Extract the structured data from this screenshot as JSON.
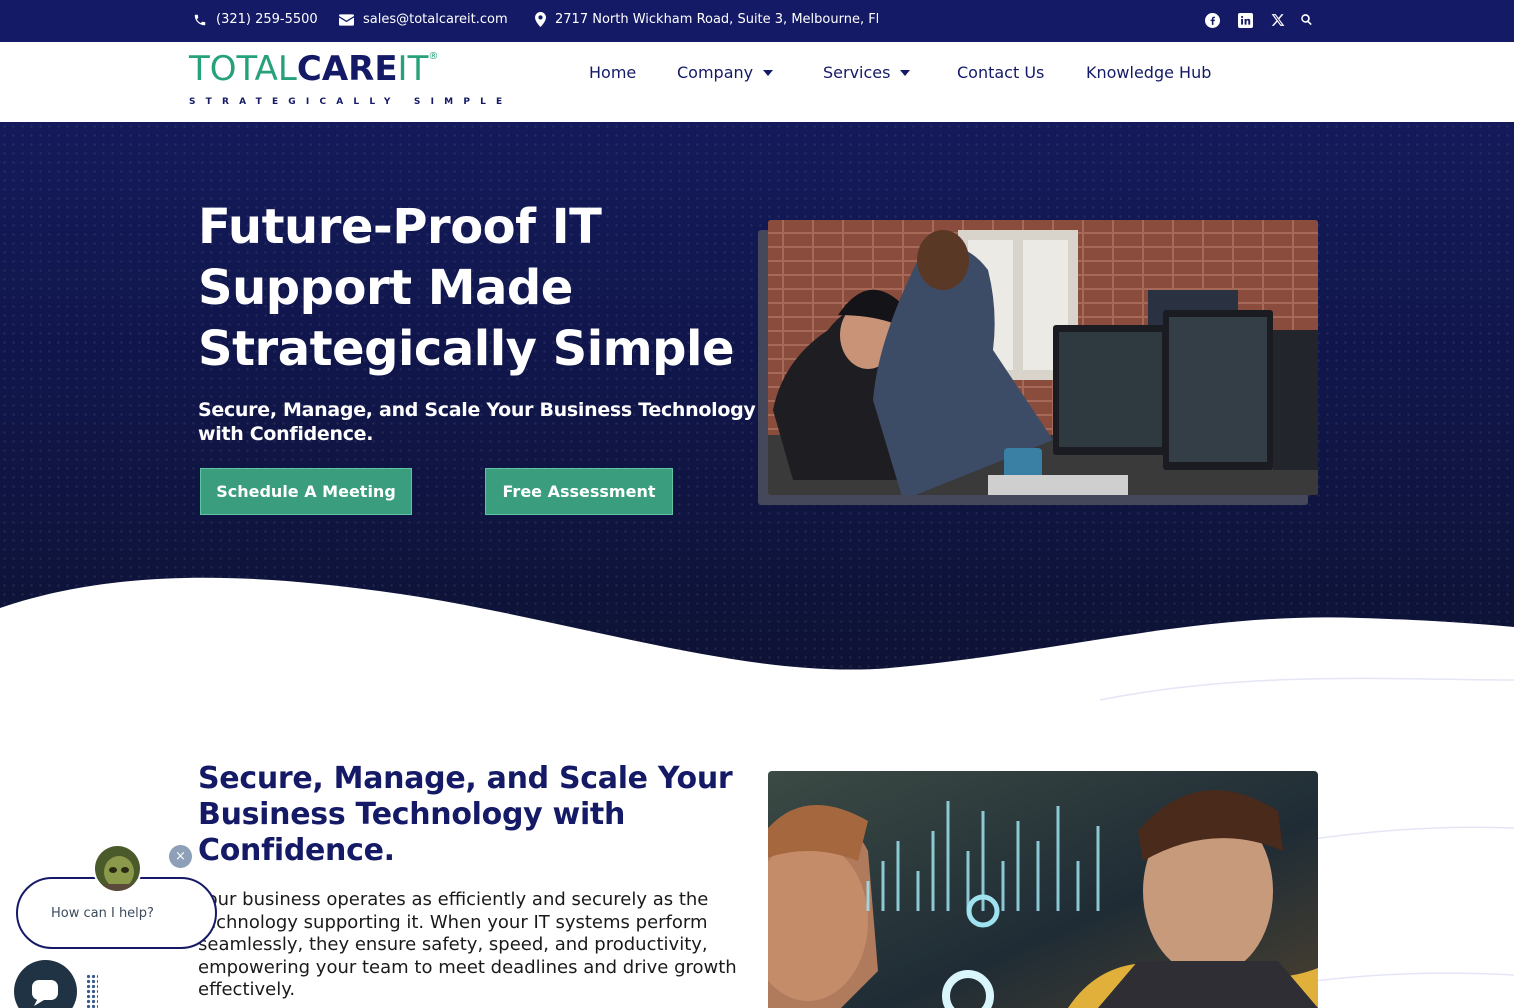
{
  "topbar": {
    "phone": "(321) 259-5500",
    "email": "sales@totalcareit.com",
    "address": "2717 North Wickham Road, Suite 3, Melbourne, Fl",
    "social_icons": [
      "facebook-icon",
      "linkedin-icon",
      "x-icon",
      "search-icon"
    ]
  },
  "logo": {
    "part1": "TOTAL",
    "part2": "CARE",
    "part3": "IT",
    "registered": "®",
    "tagline": "STRATEGICALLY SIMPLE"
  },
  "nav": {
    "home": "Home",
    "company": "Company",
    "services": "Services",
    "contact": "Contact Us",
    "knowledge": "Knowledge Hub"
  },
  "hero": {
    "title": "Future-Proof IT Support Made Strategically Simple",
    "subtitle": "Secure, Manage, and Scale Your Business Technology with Confidence.",
    "btn_meeting": "Schedule A Meeting",
    "btn_assessment": "Free Assessment"
  },
  "section2": {
    "title": "Secure, Manage, and Scale Your Business Technology with Confidence.",
    "body": "Your business operates as efficiently and securely as the technology supporting it. When your IT systems perform seamlessly, they ensure safety, speed, and productivity, empowering your team to meet deadlines and drive growth effectively."
  },
  "chat": {
    "prompt": "How can I help?",
    "close": "×"
  },
  "colors": {
    "navy": "#141a66",
    "green": "#3a9d7e",
    "brand_green": "#26a17b"
  }
}
